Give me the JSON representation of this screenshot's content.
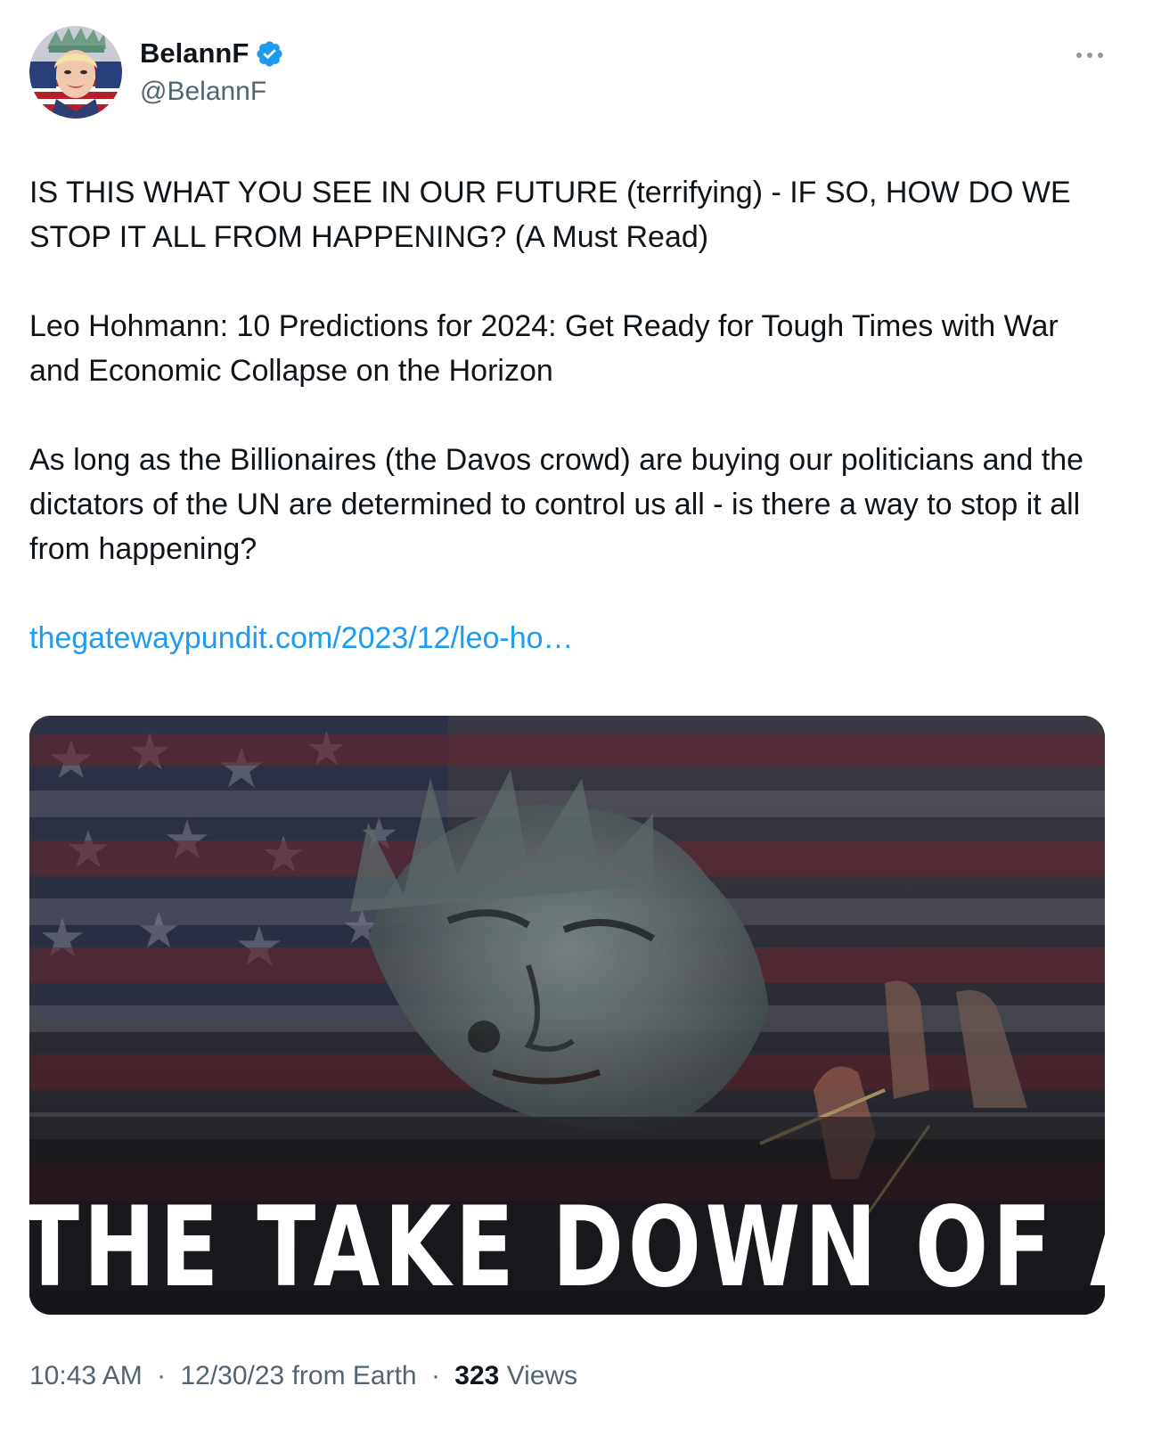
{
  "author": {
    "display_name": "BelannF",
    "handle": "@BelannF",
    "verified_icon": "verified-badge-icon",
    "verified_color": "#1d9bf0"
  },
  "more_icon": "more-horizontal-icon",
  "tweet": {
    "paragraph_1": "IS THIS WHAT YOU SEE IN OUR FUTURE (terrifying) - IF SO, HOW DO WE STOP IT ALL FROM HAPPENING? (A Must Read)",
    "paragraph_2": "Leo Hohmann: 10 Predictions for 2024: Get Ready for Tough Times with War and Economic Collapse on the Horizon",
    "paragraph_3": "As long as the Billionaires (the Davos crowd)  are buying our politicians and the dictators of the UN are determined to control us all - is there a way to stop it all from happening?",
    "link_text": "thegatewaypundit.com/2023/12/leo-ho…",
    "link_color": "#1d9bf0"
  },
  "media": {
    "caption": "THE TAKE DOWN OF AMERICA"
  },
  "meta": {
    "time": "10:43 AM",
    "separator": "·",
    "date_source": "12/30/23 from Earth",
    "views_count": "323",
    "views_label": "Views",
    "muted_color": "#536471"
  }
}
